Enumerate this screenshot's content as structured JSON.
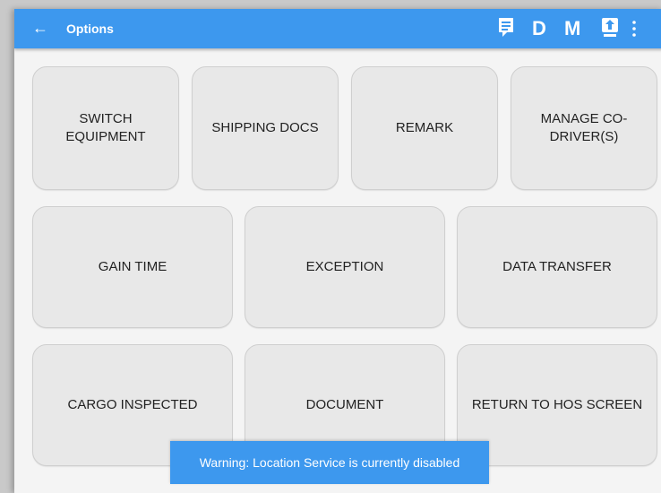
{
  "header": {
    "back_icon": "arrow-left-icon",
    "title": "Options",
    "actions": [
      {
        "icon": "message-icon"
      },
      {
        "label": "D"
      },
      {
        "label": "M"
      },
      {
        "icon": "upload-icon"
      },
      {
        "icon": "more-vert-icon"
      }
    ]
  },
  "buttons": {
    "row1": [
      "SWITCH EQUIPMENT",
      "SHIPPING DOCS",
      "REMARK",
      "MANAGE CO-DRIVER(S)"
    ],
    "row2": [
      "GAIN TIME",
      "EXCEPTION",
      "DATA TRANSFER"
    ],
    "row3": [
      "CARGO INSPECTED",
      "DOCUMENT",
      "RETURN TO HOS SCREEN"
    ]
  },
  "toast": {
    "message": "Warning: Location Service is currently disabled"
  },
  "colors": {
    "toolbar": "#3d98ee",
    "button_bg": "#e8e8e8",
    "page_bg": "#f4f4f4"
  }
}
